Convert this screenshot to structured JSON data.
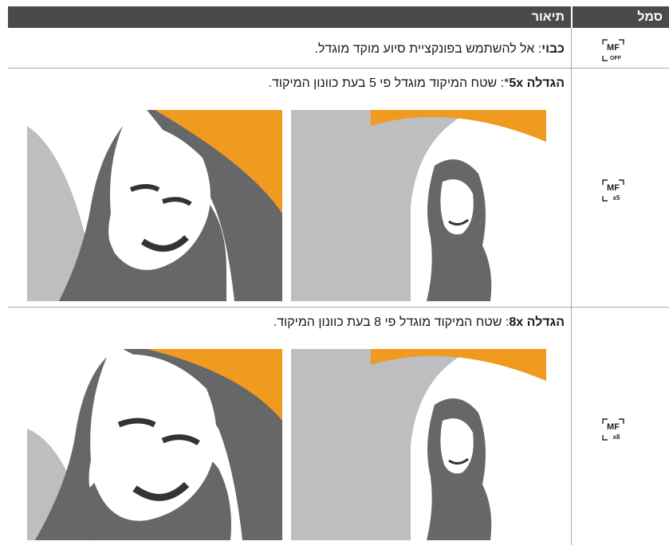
{
  "header": {
    "symbol_label": "סמל",
    "description_label": "תיאור"
  },
  "rows": [
    {
      "symbol": "mf-off-icon",
      "term": "כבוי",
      "sep": ":",
      "desc": " אל להשתמש בפונקציית סיוע מוקד מוגדל."
    },
    {
      "symbol": "mf-x5-icon",
      "term": "הגדלה 5x",
      "sep": "*:",
      "desc": " שטח המיקוד מוגדל פי 5 בעת כוונון המיקוד."
    },
    {
      "symbol": "mf-x8-icon",
      "term": "הגדלה 8x",
      "sep": ":",
      "desc": " שטח המיקוד מוגדל פי 8 בעת כוונון המיקוד."
    }
  ],
  "colors": {
    "header_bg": "#4a4a4a",
    "umbrella": "#f09a20",
    "gray_dark": "#666769",
    "gray_light": "#bdbec0"
  }
}
